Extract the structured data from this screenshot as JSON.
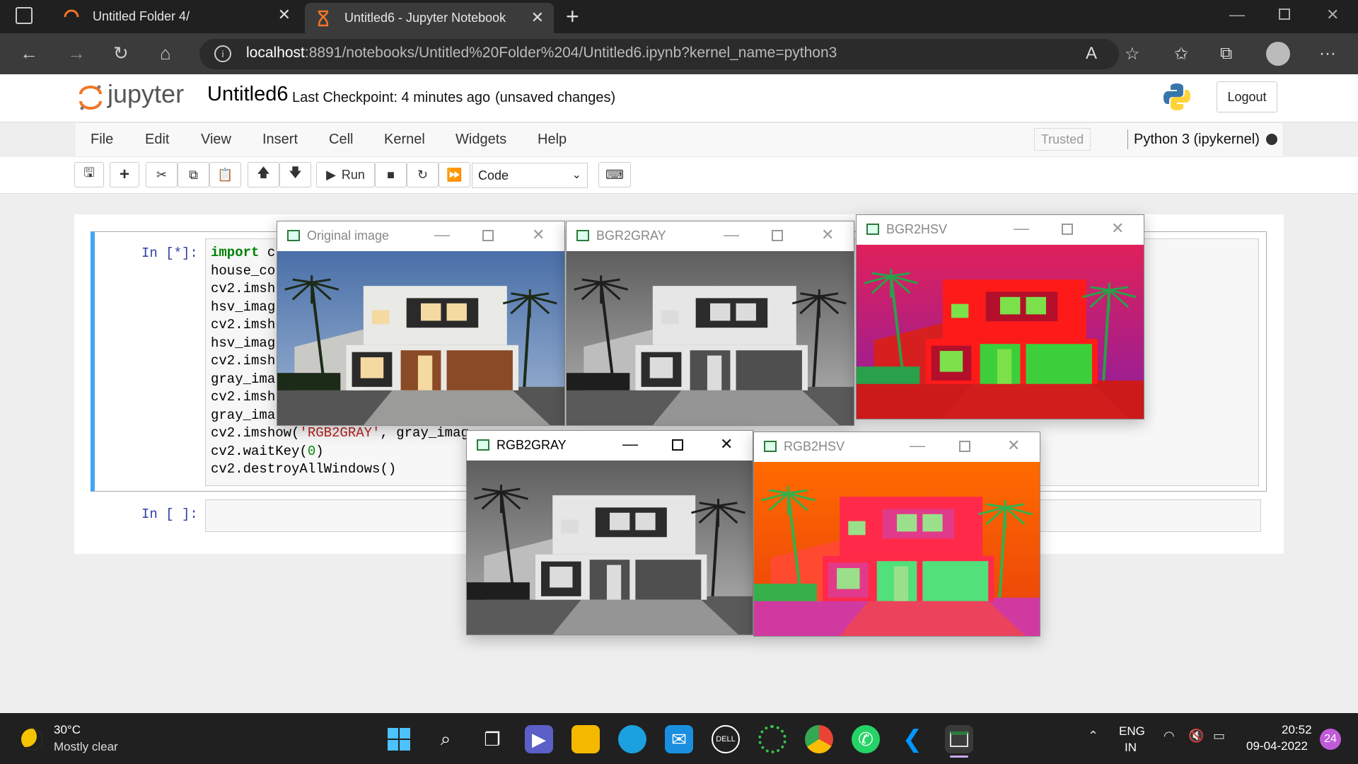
{
  "browser": {
    "tabs": [
      {
        "title": "Untitled Folder 4/"
      },
      {
        "title": "Untitled6 - Jupyter Notebook"
      }
    ],
    "url_host": "localhost",
    "url_path": ":8891/notebooks/Untitled%20Folder%204/Untitled6.ipynb?kernel_name=python3"
  },
  "jupyter": {
    "logo_text": "jupyter",
    "notebook_title": "Untitled6",
    "checkpoint": "Last Checkpoint: 4 minutes ago",
    "unsaved": "(unsaved changes)",
    "logout_label": "Logout",
    "menu": [
      "File",
      "Edit",
      "View",
      "Insert",
      "Cell",
      "Kernel",
      "Widgets",
      "Help"
    ],
    "trusted_label": "Trusted",
    "kernel_name": "Python 3 (ipykernel)",
    "run_label": "Run",
    "cell_type": "Code"
  },
  "cells": [
    {
      "prompt": "In [*]:",
      "lines": [
        "import c",
        "house_co",
        "cv2.imsh",
        "hsv_imag",
        "cv2.imsh",
        "hsv_imag",
        "cv2.imsh",
        "gray_ima",
        "cv2.imsh",
        "gray_ima",
        "cv2.imshow('RGB2GRAY', gray_imag",
        "cv2.waitKey(0)",
        "cv2.destroyAllWindows()"
      ]
    },
    {
      "prompt": "In [ ]:"
    }
  ],
  "cv_windows": [
    {
      "title": "Original image",
      "variant": "original"
    },
    {
      "title": "BGR2GRAY",
      "variant": "gray"
    },
    {
      "title": "BGR2HSV",
      "variant": "hsv"
    },
    {
      "title": "RGB2GRAY",
      "variant": "gray"
    },
    {
      "title": "RGB2HSV",
      "variant": "hsv2"
    }
  ],
  "taskbar": {
    "weather_temp": "30°C",
    "weather_desc": "Mostly clear",
    "lang_line1": "ENG",
    "lang_line2": "IN",
    "time": "20:52",
    "date": "09-04-2022",
    "notification_count": "24"
  }
}
